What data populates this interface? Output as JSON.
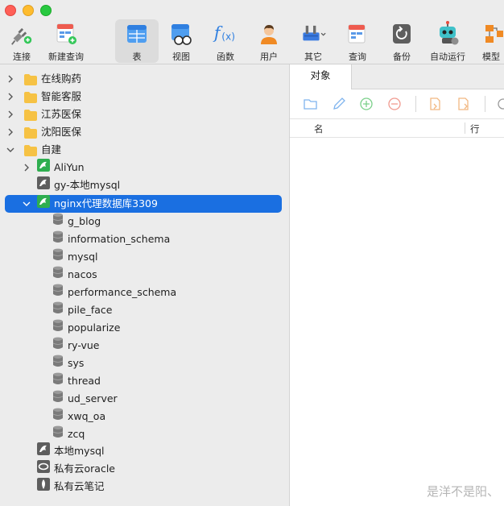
{
  "toolbar": {
    "tools": [
      {
        "key": "connect",
        "label": "连接"
      },
      {
        "key": "new_query",
        "label": "新建查询"
      },
      {
        "key": "table",
        "label": "表"
      },
      {
        "key": "view",
        "label": "视图"
      },
      {
        "key": "function",
        "label": "函数"
      },
      {
        "key": "user",
        "label": "用户"
      },
      {
        "key": "other",
        "label": "其它"
      },
      {
        "key": "query",
        "label": "查询"
      },
      {
        "key": "backup",
        "label": "备份"
      },
      {
        "key": "automation",
        "label": "自动运行"
      },
      {
        "key": "model",
        "label": "模型"
      }
    ],
    "active": "table"
  },
  "sidebar": {
    "groups": [
      {
        "label": "在线购药"
      },
      {
        "label": "智能客服"
      },
      {
        "label": "江苏医保"
      },
      {
        "label": "沈阳医保"
      },
      {
        "label": "自建"
      }
    ],
    "connections": [
      {
        "label": "AliYun"
      },
      {
        "label": "gy-本地mysql"
      },
      {
        "label": "nginx代理数据库3309"
      }
    ],
    "databases": [
      {
        "label": "g_blog"
      },
      {
        "label": "information_schema"
      },
      {
        "label": "mysql"
      },
      {
        "label": "nacos"
      },
      {
        "label": "performance_schema"
      },
      {
        "label": "pile_face"
      },
      {
        "label": "popularize"
      },
      {
        "label": "ry-vue"
      },
      {
        "label": "sys"
      },
      {
        "label": "thread"
      },
      {
        "label": "ud_server"
      },
      {
        "label": "xwq_oa"
      },
      {
        "label": "zcq"
      }
    ],
    "bottom_connections": [
      {
        "label": "本地mysql"
      },
      {
        "label": "私有云oracle"
      },
      {
        "label": "私有云笔记"
      }
    ]
  },
  "pane": {
    "tab_label": "对象",
    "columns": {
      "name": "名",
      "rows": "行"
    }
  },
  "watermark": "是洋不是阳、",
  "colors": {
    "selection": "#1a6fe1",
    "folder": "#f6c244",
    "mysql_green": "#2eae4f"
  }
}
